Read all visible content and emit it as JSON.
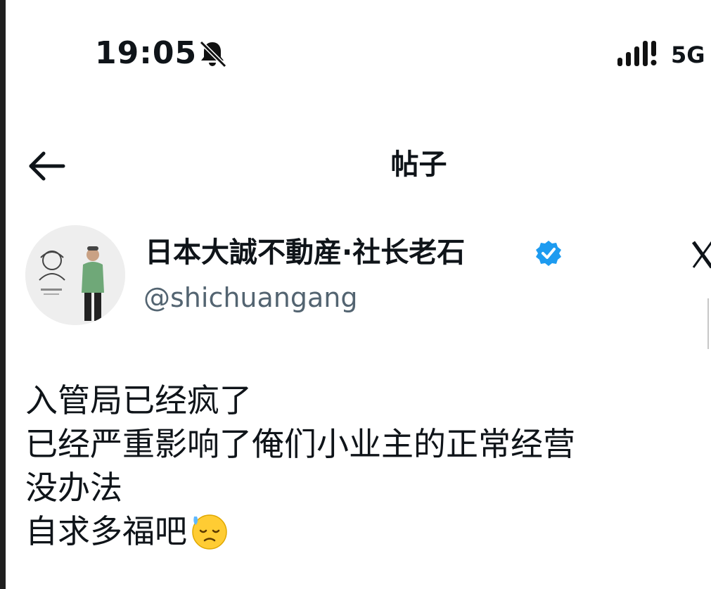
{
  "status_bar": {
    "time": "19:05",
    "network": "5G",
    "icons": [
      "bell-muted-icon",
      "signal-icon"
    ]
  },
  "nav": {
    "title": "帖子",
    "back_icon": "arrow-left-icon"
  },
  "author": {
    "display_name": "日本大誠不動産·社长老石",
    "handle": "@shichuangang",
    "verified": true,
    "verified_color": "#1d9bf0"
  },
  "post": {
    "lines": [
      "入管局已经疯了",
      "已经严重影响了俺们小业主的正常经营",
      "没办法",
      "自求多福吧"
    ],
    "trailing_emoji": "downcast-face-with-sweat-icon"
  },
  "colors": {
    "text": "#0f1419",
    "secondary": "#536471",
    "accent": "#1d9bf0"
  }
}
